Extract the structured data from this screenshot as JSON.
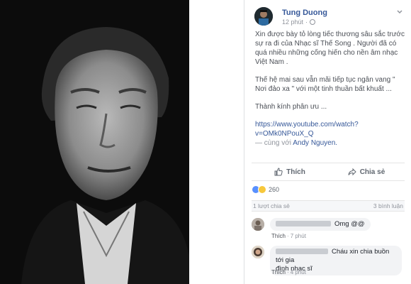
{
  "post": {
    "author": "Tung Duong",
    "time": "12 phút",
    "paragraphs": [
      "Xin được bày tỏ lòng tiếc thương sâu sắc trước sự ra đi của Nhạc sĩ Thế Song . Người đã có quá nhiều những cống hiến cho nền âm nhạc Việt Nam .",
      "Thế hệ mai sau vẫn mãi tiếp tục ngân vang \" Nơi đảo xa \" với một tinh thuần bất khuất ...",
      "Thành kính phân ưu ..."
    ],
    "link": "https://www.youtube.com/watch?v=OMk0NPouX_Q",
    "with_prefix": "— cùng với",
    "tagged": "Andy Nguyen."
  },
  "actions": {
    "like": "Thích",
    "share": "Chia sẻ"
  },
  "reactions": {
    "count": "260"
  },
  "stats": {
    "shares": "1 lượt chia sẻ",
    "comments": "3 bình luận"
  },
  "comments": [
    {
      "text": "Omg @@",
      "like": "Thích",
      "time": "7 phút"
    },
    {
      "text": "Cháu xin chia buồn tới gia đình nhạc sĩ",
      "line1": "Cháu xin chia buồn tới gia",
      "line2": "đình nhạc sĩ",
      "like": "Thích",
      "time": "4 phút"
    }
  ],
  "colors": {
    "link": "#365899",
    "like_blue": "#5890ff",
    "sad_yellow": "#f7c83c"
  }
}
